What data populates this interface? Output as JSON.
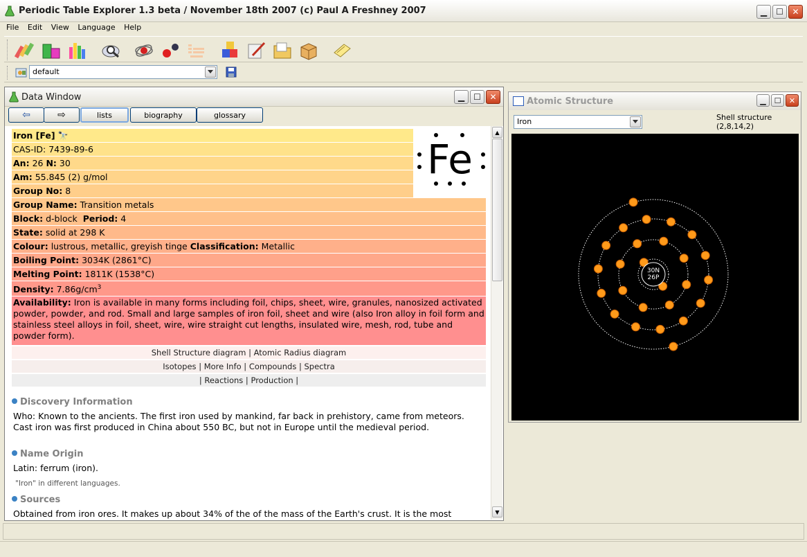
{
  "app": {
    "title": "Periodic Table Explorer 1.3 beta / November 18th 2007 (c) Paul A Freshney 2007",
    "menu": [
      "File",
      "Edit",
      "View",
      "Language",
      "Help"
    ],
    "profile_value": "default"
  },
  "toolbar_icons": [
    "pencils-icon",
    "blocks-icon",
    "bar-chart-icon",
    "magnifier-icon",
    "atom-icon",
    "molecule-icon",
    "table-icon",
    "cubes-icon",
    "write-icon",
    "folder-icon",
    "box-icon",
    "notes-icon"
  ],
  "data_window": {
    "title": "Data Window",
    "nav": {
      "back": "⇦",
      "forward": "⇨",
      "lists": "lists",
      "biography": "biography",
      "glossary": "glossary"
    },
    "symbol": "Fe",
    "rows": [
      {
        "label": "Iron [Fe]",
        "value": "",
        "color": "#ffe98a"
      },
      {
        "label": "",
        "value": "CAS-ID: 7439-89-6",
        "color": "#ffe28a"
      },
      {
        "label": "An:",
        "value": "26",
        "label2": "N:",
        "value2": "30",
        "color": "#ffd98a"
      },
      {
        "label": "Am:",
        "value": "55.845 (2) g/mol",
        "color": "#ffd48a"
      },
      {
        "label": "Group No:",
        "value": "8",
        "color": "#ffce8a"
      },
      {
        "label": "Group Name:",
        "value": "Transition metals",
        "color": "#ffc78a"
      },
      {
        "label": "Block:",
        "value": "d-block",
        "label2": "Period:",
        "value2": "4",
        "color": "#ffc08a"
      },
      {
        "label": "State:",
        "value": "solid at 298 K",
        "color": "#ffb98a"
      },
      {
        "label": "Colour:",
        "value": "lustrous, metallic, greyish tinge",
        "label2": "Classification:",
        "value2": "Metallic",
        "color": "#ffb08a"
      },
      {
        "label": "Boiling Point:",
        "value": "3034K (2861°C)",
        "color": "#ffa88a"
      },
      {
        "label": "Melting Point:",
        "value": "1811K (1538°C)",
        "color": "#ffa08a"
      },
      {
        "label": "Density:",
        "value": "7.86g/cm",
        "sup": "3",
        "color": "#ff988a"
      }
    ],
    "availability_label": "Availability:",
    "availability_text": "Iron is available in many forms including foil, chips, sheet, wire, granules, nanosized activated powder, powder, and rod. Small and large samples of iron foil, sheet and wire (also Iron alloy in foil form and stainless steel alloys in foil, sheet, wire, wire straight cut lengths, insulated wire, mesh, rod, tube and powder form).",
    "links": [
      "Shell Structure diagram | Atomic Radius diagram",
      "Isotopes | More Info | Compounds | Spectra",
      "| Reactions | Production |"
    ],
    "discovery_heading": "Discovery Information",
    "discovery_text": "Who: Known to the ancients. The first iron used by mankind, far back in prehistory, came from meteors. Cast iron was first produced in China about 550 BC, but not in Europe until the medieval period.",
    "origin_heading": "Name Origin",
    "origin_text": "Latin: ferrum (iron).",
    "origin_note": "\"Iron\" in different languages.",
    "sources_heading": "Sources",
    "sources_text": "Obtained from iron ores. It makes up about 34% of the of the mass of the Earth's crust. It is the most"
  },
  "atomic_window": {
    "title": "Atomic Structure",
    "element_select": "Iron",
    "shell_label": "Shell structure",
    "shell_value": "(2,8,14,2)",
    "shells": [
      2,
      8,
      14,
      2
    ],
    "nucleus_n": "30N",
    "nucleus_p": "26P",
    "electron_color": "#ff9a1a",
    "orbit_color": "#ffffff"
  }
}
